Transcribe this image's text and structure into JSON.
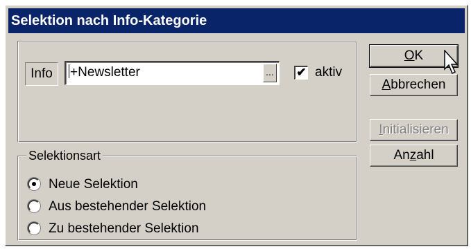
{
  "window": {
    "title": "Selektion nach Info-Kategorie"
  },
  "info": {
    "label": "Info",
    "value": "+Newsletter",
    "browse_label": "...",
    "aktiv_label": "aktiv",
    "aktiv_checked": true
  },
  "selektionsart": {
    "legend": "Selektionsart",
    "options": [
      {
        "label": "Neue Selektion",
        "selected": true
      },
      {
        "label": "Aus bestehender Selektion",
        "selected": false
      },
      {
        "label": "Zu bestehender Selektion",
        "selected": false
      }
    ]
  },
  "buttons": {
    "ok": {
      "mnemonic": "O",
      "rest": "K"
    },
    "abbrechen": {
      "mnemonic": "A",
      "rest": "bbrechen"
    },
    "initialisieren": {
      "mnemonic": "I",
      "rest": "nitialisieren",
      "disabled": true
    },
    "anzahl": {
      "pre": "An",
      "mnemonic": "z",
      "rest": "ahl"
    }
  },
  "colors": {
    "titlebar": "#0a246a",
    "face": "#d4d0c8"
  }
}
